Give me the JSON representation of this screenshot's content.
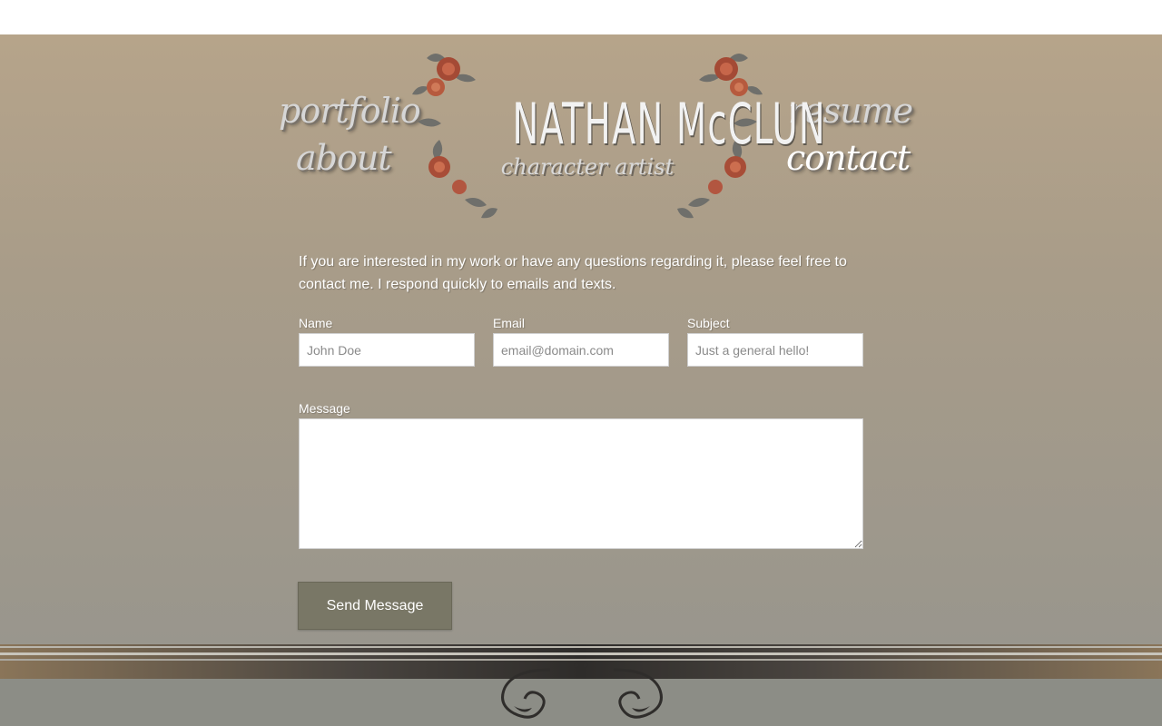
{
  "nav": {
    "portfolio": "portfolio",
    "about": "about",
    "resume": "resume",
    "contact": "contact",
    "active": "contact"
  },
  "logo": {
    "name": "NATHAN McCLUN",
    "subtitle": "character artist"
  },
  "intro": "If you are interested in my work or have any questions regarding it, please feel free to contact me. I respond quickly to emails and texts.",
  "form": {
    "name_label": "Name",
    "name_placeholder": "John Doe",
    "email_label": "Email",
    "email_placeholder": "email@domain.com",
    "subject_label": "Subject",
    "subject_placeholder": "Just a general hello!",
    "message_label": "Message",
    "message_value": "",
    "submit_label": "Send Message"
  },
  "colors": {
    "accent_button": "#797766",
    "page_top": "#b6a48a",
    "page_bottom": "#99968d",
    "footer": "#8c8d86"
  }
}
